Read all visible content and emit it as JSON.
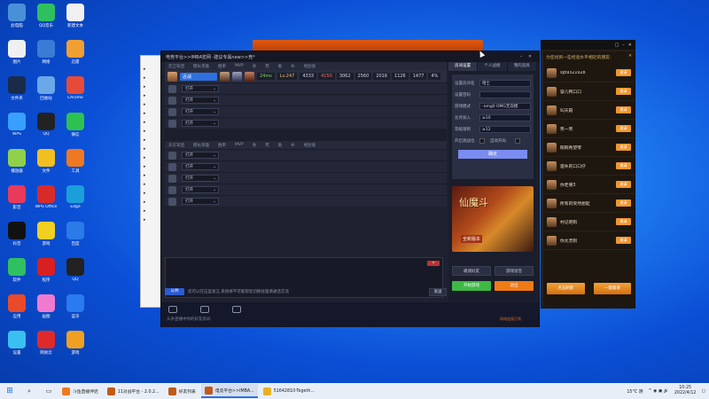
{
  "desktop_icons": [
    {
      "label": "此电脑",
      "color": "#4a90d9"
    },
    {
      "label": "QQ音乐",
      "color": "#2fbf5e"
    },
    {
      "label": "新建文本",
      "color": "#f0f0f0"
    },
    {
      "label": "图片",
      "color": "#f0f0f0"
    },
    {
      "label": "网络",
      "color": "#3a7bd5"
    },
    {
      "label": "迅雷",
      "color": "#f0a030"
    },
    {
      "label": "文件夹",
      "color": "#1a2b4a"
    },
    {
      "label": "回收站",
      "color": "#6aa8e8"
    },
    {
      "label": "Chrome",
      "color": "#e84a3a"
    },
    {
      "label": "WPS",
      "color": "#3aa0ff"
    },
    {
      "label": "QQ",
      "color": "#222"
    },
    {
      "label": "微信",
      "color": "#2dc150"
    },
    {
      "label": "播放器",
      "color": "#8fd14a"
    },
    {
      "label": "文件",
      "color": "#f0c020"
    },
    {
      "label": "工具",
      "color": "#f07820"
    },
    {
      "label": "影音",
      "color": "#e83a5a"
    },
    {
      "label": "WPS Office",
      "color": "#d92a2a"
    },
    {
      "label": "Edge",
      "color": "#1a9fd8"
    },
    {
      "label": "抖音",
      "color": "#111"
    },
    {
      "label": "游戏",
      "color": "#f0d020"
    },
    {
      "label": "百度",
      "color": "#2a7ae8"
    },
    {
      "label": "软件",
      "color": "#30c060"
    },
    {
      "label": "程序",
      "color": "#d82020"
    },
    {
      "label": "QQ",
      "color": "#222"
    },
    {
      "label": "应用",
      "color": "#e84a2a"
    },
    {
      "label": "画图",
      "color": "#f07ad0"
    },
    {
      "label": "蓝牙",
      "color": "#2a7af0"
    },
    {
      "label": "设置",
      "color": "#3ac0f0"
    },
    {
      "label": "网易云",
      "color": "#e02a2a"
    },
    {
      "label": "游戏",
      "color": "#f0a020"
    }
  ],
  "main_window": {
    "title": "电竞平台>>IMBA宏网 -建议专属new>>竞*",
    "team1_header": [
      "近卫军团",
      "擅长英雄",
      "胜率",
      "MVP",
      "杀",
      "死",
      "助",
      "补",
      "经验值"
    ],
    "me": {
      "name": "近战",
      "score": "24ms",
      "level": "Lv.247",
      "stats": [
        "4333",
        "4150",
        "3062",
        "2560",
        "2016",
        "1126",
        "1477",
        "4%"
      ]
    },
    "team1_slots": [
      "打开",
      "打开",
      "打开",
      "打开"
    ],
    "team2_header": [
      "天灾军团",
      "擅长英雄",
      "胜率",
      "MVP",
      "杀",
      "死",
      "助",
      "补",
      "经验值"
    ],
    "team2_slots": [
      "打开",
      "打开",
      "打开",
      "打开",
      "打开"
    ],
    "chat_placeholder": "您可以在这里发言,系统将不可能帮您切换处理请通话交流",
    "public_label": "公共",
    "send_label": "发送",
    "status_left": "头条直播中你的好友房间",
    "status_net": "网络连接正常"
  },
  "room_panel": {
    "tabs": [
      "房间设置",
      "个人战绩",
      "我的道具"
    ],
    "fields": [
      {
        "key": "设置房间名",
        "value": "哈士"
      },
      {
        "key": "设置密码",
        "value": ""
      },
      {
        "key": "游戏模式",
        "value": "-omg0 OMG无双模"
      },
      {
        "key": "允许加入",
        "value": "≥10"
      },
      {
        "key": "等级限制",
        "value": "≥12"
      }
    ],
    "checks": [
      "开启观战位",
      "自动开局"
    ],
    "ok_label": "确定",
    "banner_title": "仙魔斗",
    "banner_sub": "全新版本",
    "btn_invite": "邀请好友",
    "btn_voice": "游戏语音",
    "btn_start": "开始游戏",
    "btn_exit": "退出"
  },
  "friend_panel": {
    "header": "为您找到一些经验水平相近的朋友:",
    "friends": [
      {
        "name": "xjb9321928",
        "invite": "邀请"
      },
      {
        "name": "穿儿鸭口口",
        "invite": "邀请"
      },
      {
        "name": "叫天殿",
        "invite": "邀请"
      },
      {
        "name": "笑一笑",
        "invite": "邀请"
      },
      {
        "name": "碗碗希望零",
        "invite": "邀请"
      },
      {
        "name": "遗失的口口仔",
        "invite": "邀请"
      },
      {
        "name": "你老婆3",
        "invite": "邀请"
      },
      {
        "name": "所有的突然想起",
        "invite": "邀请"
      },
      {
        "name": "村记吧则",
        "invite": "邀请"
      },
      {
        "name": "你太灵则",
        "invite": "邀请"
      }
    ],
    "refresh": "点击刷新",
    "invite_all": "一键邀请"
  },
  "taskbar": {
    "items": [
      {
        "label": "斗鱼直播伴侣",
        "color": "#f07820",
        "active": false
      },
      {
        "label": "11对战平台 - 2.0.2...",
        "color": "#c05a1a",
        "active": false
      },
      {
        "label": "好友列表",
        "color": "#c05a1a",
        "active": false
      },
      {
        "label": "电竞平台>>IMBA...",
        "color": "#c05a1a",
        "active": true
      },
      {
        "label": "51642810-Togeth...",
        "color": "#e8b020",
        "active": false
      }
    ],
    "weather": "15°C 阴",
    "time": "10:25",
    "date": "2022/4/12"
  }
}
